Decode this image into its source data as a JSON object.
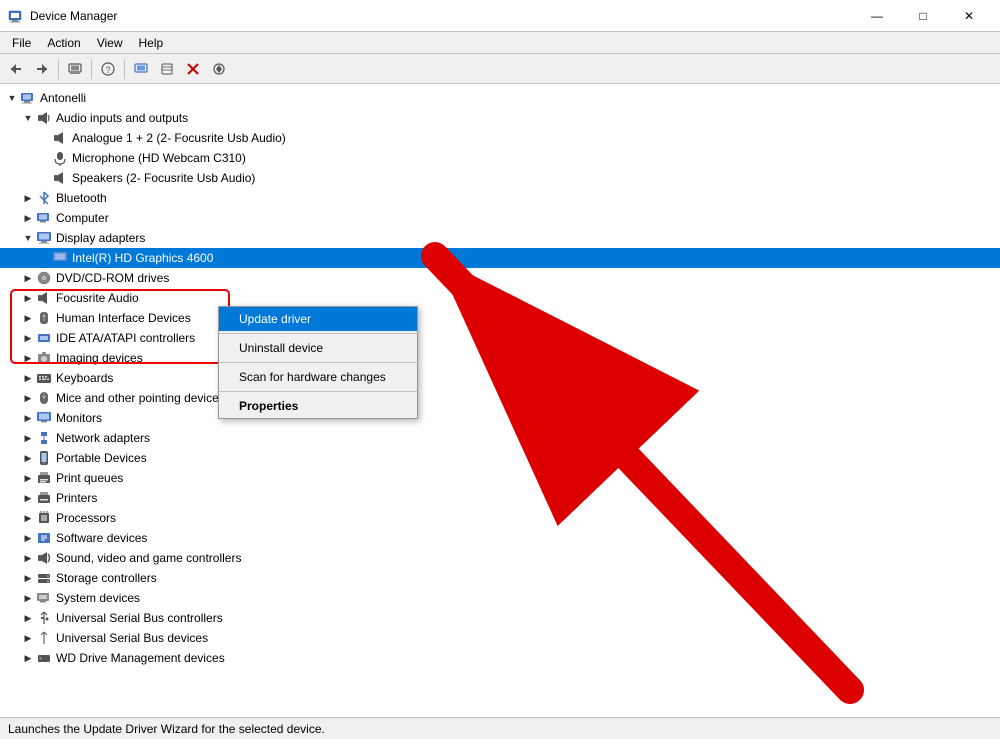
{
  "window": {
    "title": "Device Manager",
    "controls": {
      "minimize": "—",
      "maximize": "□",
      "close": "✕"
    }
  },
  "menubar": {
    "items": [
      "File",
      "Action",
      "View",
      "Help"
    ]
  },
  "toolbar": {
    "buttons": [
      "◀",
      "▶",
      "🖥",
      "❓",
      "🖥",
      "📋",
      "✖",
      "⬇"
    ]
  },
  "tree": {
    "items": [
      {
        "id": "antonelli",
        "label": "Antonelli",
        "indent": 1,
        "expanded": true,
        "icon": "computer",
        "expander": "▼"
      },
      {
        "id": "audio",
        "label": "Audio inputs and outputs",
        "indent": 2,
        "expanded": true,
        "icon": "audio",
        "expander": "▼"
      },
      {
        "id": "analogue",
        "label": "Analogue 1 + 2 (2- Focusrite Usb Audio)",
        "indent": 3,
        "expanded": false,
        "icon": "device",
        "expander": ""
      },
      {
        "id": "microphone",
        "label": "Microphone (HD Webcam C310)",
        "indent": 3,
        "expanded": false,
        "icon": "device",
        "expander": ""
      },
      {
        "id": "speakers",
        "label": "Speakers (2- Focusrite Usb Audio)",
        "indent": 3,
        "expanded": false,
        "icon": "device",
        "expander": ""
      },
      {
        "id": "bluetooth",
        "label": "Bluetooth",
        "indent": 2,
        "expanded": false,
        "icon": "bluetooth",
        "expander": "▶"
      },
      {
        "id": "computer",
        "label": "Computer",
        "indent": 2,
        "expanded": false,
        "icon": "computer-sm",
        "expander": "▶"
      },
      {
        "id": "display",
        "label": "Display adapters",
        "indent": 2,
        "expanded": true,
        "icon": "display",
        "expander": "▼"
      },
      {
        "id": "intel",
        "label": "Intel(R) HD Graphics 4600",
        "indent": 3,
        "expanded": false,
        "icon": "display-dev",
        "expander": ""
      },
      {
        "id": "dvd",
        "label": "DVD/CD-ROM drives",
        "indent": 2,
        "expanded": false,
        "icon": "dvd",
        "expander": "▶"
      },
      {
        "id": "focusrite",
        "label": "Focusrite Audio",
        "indent": 2,
        "expanded": false,
        "icon": "audio-dev",
        "expander": "▶"
      },
      {
        "id": "hid",
        "label": "Human Interface Devices",
        "indent": 2,
        "expanded": false,
        "icon": "hid",
        "expander": "▶"
      },
      {
        "id": "ide",
        "label": "IDE ATA/ATAPI controllers",
        "indent": 2,
        "expanded": false,
        "icon": "ide",
        "expander": "▶"
      },
      {
        "id": "imaging",
        "label": "Imaging devices",
        "indent": 2,
        "expanded": false,
        "icon": "imaging",
        "expander": "▶"
      },
      {
        "id": "keyboards",
        "label": "Keyboards",
        "indent": 2,
        "expanded": false,
        "icon": "keyboard",
        "expander": "▶"
      },
      {
        "id": "mice",
        "label": "Mice and other pointing devices",
        "indent": 2,
        "expanded": false,
        "icon": "mouse",
        "expander": "▶"
      },
      {
        "id": "monitors",
        "label": "Monitors",
        "indent": 2,
        "expanded": false,
        "icon": "monitor",
        "expander": "▶"
      },
      {
        "id": "network",
        "label": "Network adapters",
        "indent": 2,
        "expanded": false,
        "icon": "network",
        "expander": "▶"
      },
      {
        "id": "portable",
        "label": "Portable Devices",
        "indent": 2,
        "expanded": false,
        "icon": "portable",
        "expander": "▶"
      },
      {
        "id": "print-queues",
        "label": "Print queues",
        "indent": 2,
        "expanded": false,
        "icon": "print",
        "expander": "▶"
      },
      {
        "id": "printers",
        "label": "Printers",
        "indent": 2,
        "expanded": false,
        "icon": "printer",
        "expander": "▶"
      },
      {
        "id": "processors",
        "label": "Processors",
        "indent": 2,
        "expanded": false,
        "icon": "processor",
        "expander": "▶"
      },
      {
        "id": "software",
        "label": "Software devices",
        "indent": 2,
        "expanded": false,
        "icon": "software",
        "expander": "▶"
      },
      {
        "id": "sound",
        "label": "Sound, video and game controllers",
        "indent": 2,
        "expanded": false,
        "icon": "sound",
        "expander": "▶"
      },
      {
        "id": "storage",
        "label": "Storage controllers",
        "indent": 2,
        "expanded": false,
        "icon": "storage",
        "expander": "▶"
      },
      {
        "id": "system",
        "label": "System devices",
        "indent": 2,
        "expanded": false,
        "icon": "system",
        "expander": "▶"
      },
      {
        "id": "usb-controllers",
        "label": "Universal Serial Bus controllers",
        "indent": 2,
        "expanded": false,
        "icon": "usb",
        "expander": "▶"
      },
      {
        "id": "usb-devices",
        "label": "Universal Serial Bus devices",
        "indent": 2,
        "expanded": false,
        "icon": "usb-dev",
        "expander": "▶"
      },
      {
        "id": "wd",
        "label": "WD Drive Management devices",
        "indent": 2,
        "expanded": false,
        "icon": "wd",
        "expander": "▶"
      }
    ]
  },
  "context_menu": {
    "items": [
      {
        "id": "update-driver",
        "label": "Update driver",
        "highlighted": true,
        "bold": false
      },
      {
        "id": "separator1",
        "type": "separator"
      },
      {
        "id": "uninstall",
        "label": "Uninstall device",
        "highlighted": false,
        "bold": false
      },
      {
        "id": "separator2",
        "type": "separator"
      },
      {
        "id": "scan",
        "label": "Scan for hardware changes",
        "highlighted": false,
        "bold": false
      },
      {
        "id": "separator3",
        "type": "separator"
      },
      {
        "id": "properties",
        "label": "Properties",
        "highlighted": false,
        "bold": true
      }
    ]
  },
  "status_bar": {
    "text": "Launches the Update Driver Wizard for the selected device."
  },
  "icons": {
    "computer_unicode": "🖥",
    "audio_unicode": "🔊",
    "device_unicode": "🔌",
    "display_unicode": "📺",
    "bluetooth_unicode": "🔷",
    "dvd_unicode": "💿",
    "usb_unicode": "🔌",
    "generic_unicode": "⚙"
  }
}
